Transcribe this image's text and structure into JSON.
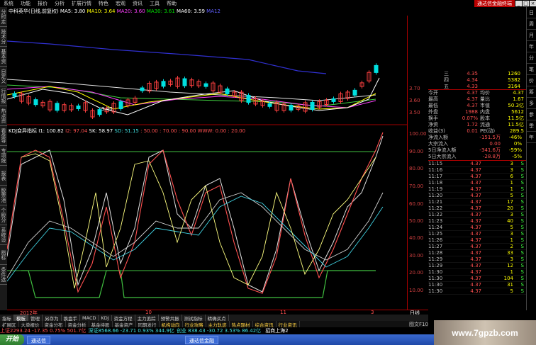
{
  "menubar": {
    "items": [
      "系统",
      "功能",
      "报价",
      "分析",
      "扩展行情",
      "特色",
      "宏观",
      "资讯",
      "工具",
      "帮助"
    ],
    "brand": "通达信金融终端"
  },
  "leftbar": {
    "tabs": [
      "分时走势",
      "技术分析",
      "基本资料",
      "自定义",
      "行情报价",
      "热点资讯",
      "看盘导航",
      "专项统计",
      "报表",
      "股票池",
      "个股分析",
      "系统设置",
      "指标",
      "条件选股"
    ]
  },
  "rightbar": {
    "tabs": [
      "日",
      "周",
      "月",
      "年",
      "分",
      "笔",
      "价",
      "筹",
      "多",
      "参",
      "季",
      "年"
    ]
  },
  "price_title": {
    "stock": "中科英华(日线,前复权)",
    "ma5": "MA5: 3.80",
    "ma10": "MA10: 3.64",
    "ma20": "MA20: 3.60",
    "ma30": "MA30: 3.61",
    "ma60": "MA60: 3.59",
    "ma120": "MA12"
  },
  "indicator_title": {
    "name": "KDJ变异指标",
    "i1": "I1: 100.82",
    "i2": "I2: 97.04",
    "sk": "SK: 58.97",
    "sd": "SD: 51.15",
    "levels": ": 50.00 : 70.00 : 90.00 WWW: 0.00 : 20.00"
  },
  "price_axis": [
    "3.70",
    "3.60",
    "3.50"
  ],
  "ind_axis": [
    "100.00",
    "90.00",
    "80.00",
    "70.00",
    "60.00",
    "50.00",
    "40.00",
    "30.00",
    "20.00",
    "10.00"
  ],
  "order_book": [
    {
      "k": "三",
      "v": "4.35",
      "n": "1260"
    },
    {
      "k": "四",
      "v": "4.34",
      "n": "5382"
    },
    {
      "k": "五",
      "v": "4.33",
      "n": "3164"
    }
  ],
  "stats": [
    {
      "k": "今开",
      "v1": "4.37",
      "k2": "均价",
      "v2": "4.37"
    },
    {
      "k": "最高",
      "v1": "4.37",
      "k2": "量比",
      "v2": "1.67"
    },
    {
      "k": "最低",
      "v1": "4.37",
      "k2": "市值",
      "v2": "50.3亿"
    },
    {
      "k": "外盘",
      "v1": "1988",
      "k2": "内盘",
      "v2": "5612"
    },
    {
      "k": "换手",
      "v1": "0.07%",
      "k2": "股本",
      "v2": "11.5亿"
    },
    {
      "k": "净资",
      "v1": "1.72",
      "k2": "流通",
      "v2": "11.5亿"
    },
    {
      "k": "收益(3)",
      "v1": "0.01",
      "k2": "PE(动)",
      "v2": "289.5"
    },
    {
      "k": "净流入额",
      "v1": "-151.5万",
      "k2": "",
      "v2": "-46%"
    },
    {
      "k": "大宗流入",
      "v1": "0.00",
      "k2": "",
      "v2": "0%"
    },
    {
      "k": "5日净流入额",
      "v1": "-341.6万",
      "k2": "",
      "v2": "-59%"
    },
    {
      "k": "5日大宗流入",
      "v1": "-28.8万",
      "k2": "",
      "v2": "-5%"
    }
  ],
  "ticks": [
    {
      "t": "11:15",
      "p": "4.37",
      "vol": "3",
      "bs": "S"
    },
    {
      "t": "11:16",
      "p": "4.37",
      "vol": "3",
      "bs": "S"
    },
    {
      "t": "11:17",
      "p": "4.37",
      "vol": "6",
      "bs": "S"
    },
    {
      "t": "11:18",
      "p": "4.37",
      "vol": "1",
      "bs": "S"
    },
    {
      "t": "11:19",
      "p": "4.37",
      "vol": "1",
      "bs": "S"
    },
    {
      "t": "11:20",
      "p": "4.37",
      "vol": "5",
      "bs": "S"
    },
    {
      "t": "11:21",
      "p": "4.37",
      "vol": "17",
      "bs": "S"
    },
    {
      "t": "11:22",
      "p": "4.37",
      "vol": "20",
      "bs": "S"
    },
    {
      "t": "11:22",
      "p": "4.37",
      "vol": "3",
      "bs": "S"
    },
    {
      "t": "11:23",
      "p": "4.37",
      "vol": "40",
      "bs": "S"
    },
    {
      "t": "11:24",
      "p": "4.37",
      "vol": "5",
      "bs": "S"
    },
    {
      "t": "11:25",
      "p": "4.37",
      "vol": "3",
      "bs": "S"
    },
    {
      "t": "11:26",
      "p": "4.37",
      "vol": "1",
      "bs": "S"
    },
    {
      "t": "11:27",
      "p": "4.37",
      "vol": "2",
      "bs": "S"
    },
    {
      "t": "11:28",
      "p": "4.37",
      "vol": "33",
      "bs": "S"
    },
    {
      "t": "11:29",
      "p": "4.37",
      "vol": "3",
      "bs": "S"
    },
    {
      "t": "11:29",
      "p": "4.37",
      "vol": "12",
      "bs": "S"
    },
    {
      "t": "11:30",
      "p": "4.37",
      "vol": "1",
      "bs": "S"
    },
    {
      "t": "11:30",
      "p": "4.37",
      "vol": "104",
      "bs": "S"
    },
    {
      "t": "11:30",
      "p": "4.37",
      "vol": "31",
      "bs": "S"
    },
    {
      "t": "11:30",
      "p": "4.37",
      "vol": "5",
      "bs": "S"
    }
  ],
  "date_axis": {
    "year": "2012年",
    "m1": "10",
    "m2": "11",
    "m3": "3",
    "right": "日线"
  },
  "tabs1": [
    "指标",
    "模板",
    "管理",
    "另存为",
    "换盘手",
    "MACD",
    "KDJ",
    "资金方程",
    "主力追踪",
    "预警共振",
    "测试指标",
    "精确买点"
  ],
  "tabs2": [
    "扩展区",
    "大单报价",
    "资金分布",
    "资金分析",
    "基金持股",
    "基金资产",
    "同期发行",
    "机构动向",
    "行业攻略",
    "主力轨迹",
    "热点题材",
    "综合资讯",
    "行业资讯"
  ],
  "rtab2": "图文F10",
  "status": {
    "sh": "上证2293.24 -17.35  0.75% 501.7亿",
    "sz": "深证8568.66 -23.71 0.93% 344.9亿",
    "cy": "创业 838.43 -30.72 3.53% 86.42亿",
    "hint": "招商上海2"
  },
  "taskbar": {
    "start": "开始",
    "tasks": [
      "通达信",
      "通达信金融"
    ]
  },
  "watermark": "www.7gpzb.com",
  "colors": {
    "up": "#ff4040",
    "down": "#00e0e0",
    "bg": "#000000",
    "accent": "#b00000"
  }
}
